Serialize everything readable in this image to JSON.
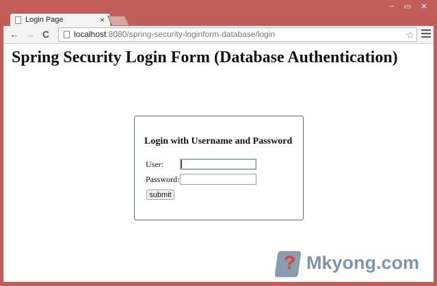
{
  "browser": {
    "tab_title": "Login Page",
    "tab_close": "×",
    "url_host": "localhost",
    "url_path": ":8080/spring-security-loginform-database/login",
    "window_controls": [
      "–",
      "▭",
      "✕"
    ],
    "nav": {
      "back": "←",
      "forward": "→",
      "reload": "C"
    },
    "star": "☆"
  },
  "page": {
    "title": "Spring Security Login Form (Database Authentication)"
  },
  "login": {
    "heading": "Login with Username and Password",
    "user_label": "User:",
    "password_label": "Password:",
    "username_value": "",
    "password_value": "",
    "submit_label": "submit"
  },
  "watermark": {
    "q_mark": "?",
    "text": "Mkyong.com"
  }
}
